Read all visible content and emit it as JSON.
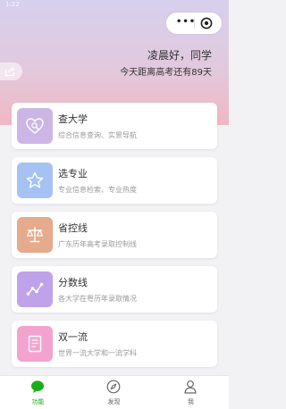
{
  "status_bar": {
    "time": "1:22"
  },
  "header": {
    "greeting": "凌晨好，同学",
    "countdown": "今天距离高考还有89天"
  },
  "capsule": {
    "menu_icon": "more-dots-icon",
    "close_icon": "target-circle-icon"
  },
  "features": [
    {
      "title": "查大学",
      "desc": "综合信息查询、实景导航",
      "icon": "heart-search-icon",
      "color": "#cbb6e6"
    },
    {
      "title": "选专业",
      "desc": "专业信息检索、专业热度",
      "icon": "star-icon",
      "color": "#a5c2f3"
    },
    {
      "title": "省控线",
      "desc": "广东历年高考录取控制线",
      "icon": "balance-scale-icon",
      "color": "#e6aa8c"
    },
    {
      "title": "分数线",
      "desc": "各大学在粤历年录取情况",
      "icon": "trend-line-icon",
      "color": "#c0a2ea"
    },
    {
      "title": "双一流",
      "desc": "世界一流大学和一流学科",
      "icon": "document-icon",
      "color": "#f2a4cf"
    }
  ],
  "tabbar": {
    "items": [
      {
        "label": "功能",
        "icon": "chat-bubble-icon",
        "active": true
      },
      {
        "label": "发现",
        "icon": "compass-icon",
        "active": false
      },
      {
        "label": "我",
        "icon": "person-icon",
        "active": false
      }
    ],
    "active_color": "#1aad19"
  }
}
